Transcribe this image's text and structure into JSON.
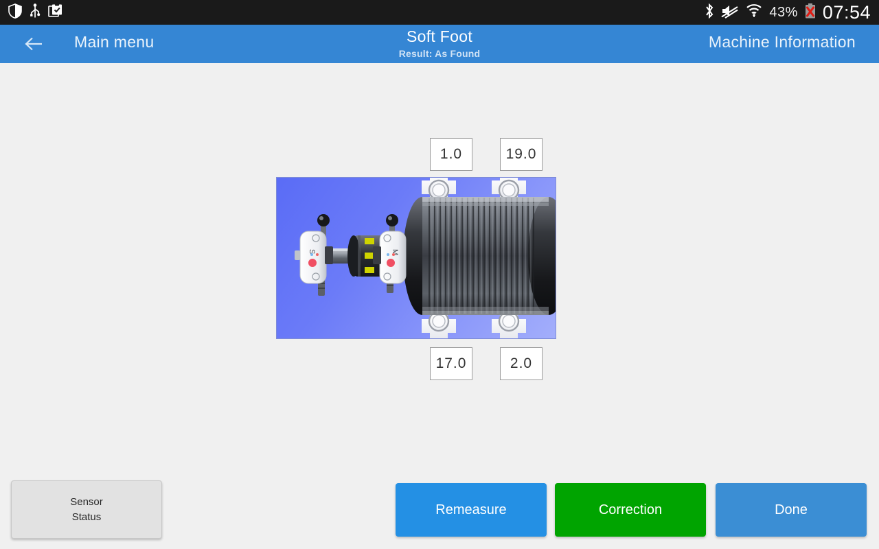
{
  "statusbar": {
    "left_icons": [
      {
        "name": "shield-icon",
        "label": "shield"
      },
      {
        "name": "usb-icon",
        "label": "usb"
      },
      {
        "name": "clipboard-check-icon",
        "label": "clipboard-check"
      }
    ],
    "right_icons": [
      {
        "name": "bluetooth-icon",
        "label": "bluetooth"
      },
      {
        "name": "volume-mute-icon",
        "label": "volume-muted"
      },
      {
        "name": "wifi-icon",
        "label": "wifi"
      }
    ],
    "battery_percent": "43%",
    "battery_status_icon": "battery-error-icon",
    "clock": "07:54"
  },
  "header": {
    "back_icon": "back-arrow-icon",
    "menu_label": "Main menu",
    "title": "Soft Foot",
    "subtitle": "Result: As Found",
    "machine_info_label": "Machine Information",
    "bar_color": "#3586d4"
  },
  "main": {
    "machine_image_alt": "motor-with-alignment-sensors",
    "values": {
      "top_left": "1.0",
      "top_right": "19.0",
      "bottom_left": "17.0",
      "bottom_right": "2.0"
    }
  },
  "footer": {
    "sensor_status_line1": "Sensor",
    "sensor_status_line2": "Status",
    "remeasure_label": "Remeasure",
    "correction_label": "Correction",
    "done_label": "Done",
    "colors": {
      "remeasure": "#2490e4",
      "correction": "#00a400",
      "done": "#3b8ed4",
      "sensor_status": "#e2e2e2"
    }
  }
}
